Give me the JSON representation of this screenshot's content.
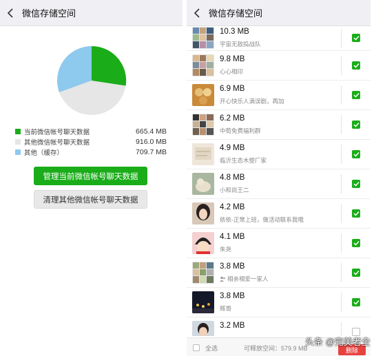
{
  "left": {
    "title": "微信存储空间",
    "pie": {
      "colors": {
        "current": "#1aad19",
        "other_accounts": "#e6e6e6",
        "cache": "#8ec9ee"
      }
    },
    "legend": [
      {
        "label": "当前微信帐号聊天数据",
        "value": "665.4 MB",
        "color": "#1aad19"
      },
      {
        "label": "其他微信帐号聊天数据",
        "value": "916.0 MB",
        "color": "#e6e6e6"
      },
      {
        "label": "其他（缓存）",
        "value": "709.7 MB",
        "color": "#8ec9ee"
      }
    ],
    "manage_button": "管理当前微信帐号聊天数据",
    "clear_button": "清理其他微信帐号聊天数据"
  },
  "right": {
    "title": "微信存储空间",
    "items": [
      {
        "size": "10.3 MB",
        "name": "宇宙无敌捣战队",
        "checked": true
      },
      {
        "size": "9.8 MB",
        "name": "心心相印",
        "checked": true
      },
      {
        "size": "6.9 MB",
        "name": "开心快乐人满误剧，再加",
        "checked": true
      },
      {
        "size": "6.2 MB",
        "name": "中荀免费福利群",
        "checked": true
      },
      {
        "size": "4.9 MB",
        "name": "临沂生态木塑厂家",
        "checked": true
      },
      {
        "size": "4.8 MB",
        "name": "小和尚王二",
        "checked": true
      },
      {
        "size": "4.2 MB",
        "name": "依依-正常上班，做活动联系我哦",
        "checked": true
      },
      {
        "size": "4.1 MB",
        "name": "朱尧",
        "checked": true
      },
      {
        "size": "3.8 MB",
        "name": "相亲相爱一家人",
        "checked": true
      },
      {
        "size": "3.8 MB",
        "name": "辉哥",
        "checked": true
      },
      {
        "size": "3.2 MB",
        "name": "",
        "checked": false
      }
    ],
    "footer": {
      "select_all": "全选",
      "free_space": "可释放空间：579.9 MB",
      "delete": "删除"
    }
  },
  "watermark": "头条 @完美者全"
}
